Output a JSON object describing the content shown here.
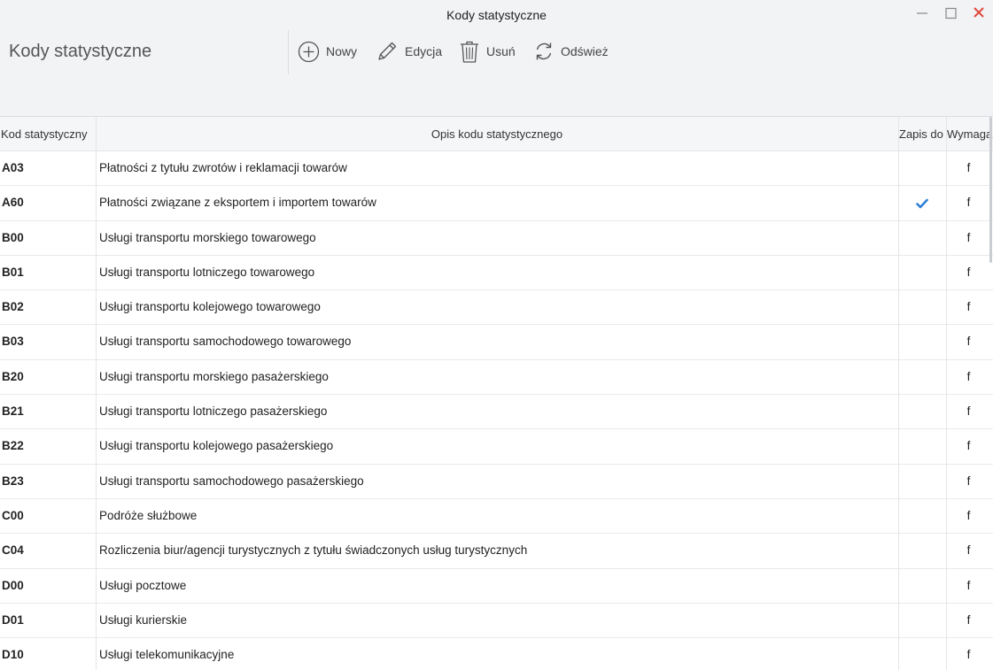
{
  "window": {
    "title": "Kody statystyczne"
  },
  "header": {
    "title": "Kody statystyczne"
  },
  "toolbar": {
    "new_label": "Nowy",
    "edit_label": "Edycja",
    "delete_label": "Usuń",
    "refresh_label": "Odśwież"
  },
  "table": {
    "columns": [
      "Kod statystyczny",
      "Opis kodu statystycznego",
      "Zapis do",
      "Wymaga"
    ],
    "rows": [
      {
        "kod": "A03",
        "opis": "Płatności z tytułu zwrotów i reklamacji towarów",
        "zapis": false,
        "wymaga": "f"
      },
      {
        "kod": "A60",
        "opis": "Płatności związane z eksportem i importem towarów",
        "zapis": true,
        "wymaga": "f"
      },
      {
        "kod": "B00",
        "opis": "Usługi transportu morskiego towarowego",
        "zapis": false,
        "wymaga": "f"
      },
      {
        "kod": "B01",
        "opis": "Usługi transportu lotniczego towarowego",
        "zapis": false,
        "wymaga": "f"
      },
      {
        "kod": "B02",
        "opis": "Usługi transportu kolejowego towarowego",
        "zapis": false,
        "wymaga": "f"
      },
      {
        "kod": "B03",
        "opis": "Usługi transportu samochodowego towarowego",
        "zapis": false,
        "wymaga": "f"
      },
      {
        "kod": "B20",
        "opis": "Usługi transportu morskiego pasażerskiego",
        "zapis": false,
        "wymaga": "f"
      },
      {
        "kod": "B21",
        "opis": "Usługi transportu lotniczego pasażerskiego",
        "zapis": false,
        "wymaga": "f"
      },
      {
        "kod": "B22",
        "opis": "Usługi transportu kolejowego pasażerskiego",
        "zapis": false,
        "wymaga": "f"
      },
      {
        "kod": "B23",
        "opis": "Usługi transportu samochodowego pasażerskiego",
        "zapis": false,
        "wymaga": "f"
      },
      {
        "kod": "C00",
        "opis": "Podróże służbowe",
        "zapis": false,
        "wymaga": "f"
      },
      {
        "kod": "C04",
        "opis": "Rozliczenia biur/agencji turystycznych z tytułu świadczonych usług turystycznych",
        "zapis": false,
        "wymaga": "f"
      },
      {
        "kod": "D00",
        "opis": "Usługi pocztowe",
        "zapis": false,
        "wymaga": "f"
      },
      {
        "kod": "D01",
        "opis": "Usługi kurierskie",
        "zapis": false,
        "wymaga": "f"
      },
      {
        "kod": "D10",
        "opis": "Usługi telekomunikacyjne",
        "zapis": false,
        "wymaga": "f"
      }
    ]
  },
  "colors": {
    "check": "#2f7fd6",
    "close": "#e04a3f"
  }
}
